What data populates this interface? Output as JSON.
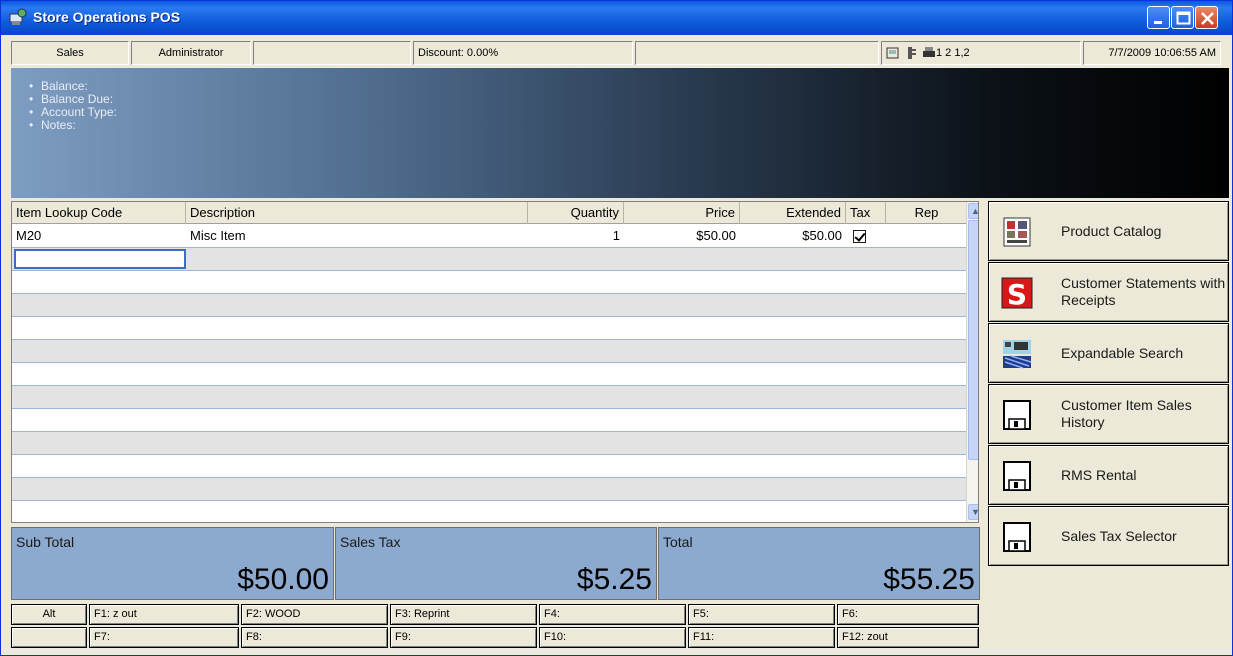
{
  "window": {
    "title": "Store Operations POS"
  },
  "status_bar": {
    "mode": "Sales",
    "user": "Administrator",
    "empty1": "",
    "discount": "Discount: 0.00%",
    "empty2": "",
    "drawers": "1 2 1,2",
    "datetime": "7/7/2009 10:06:55 AM"
  },
  "info_panel": {
    "items": [
      "Balance:",
      "Balance Due:",
      "Account Type:",
      "Notes:"
    ]
  },
  "grid": {
    "columns": [
      "Item Lookup Code",
      "Description",
      "Quantity",
      "Price",
      "Extended",
      "Tax",
      "Rep"
    ],
    "rows": [
      {
        "code": "M20",
        "description": "Misc Item",
        "quantity": "1",
        "price": "$50.00",
        "extended": "$50.00",
        "tax": true,
        "rep": ""
      }
    ]
  },
  "totals": {
    "subtotal_label": "Sub Total",
    "subtotal": "$50.00",
    "tax_label": "Sales Tax",
    "tax": "$5.25",
    "total_label": "Total",
    "total": "$55.25"
  },
  "fkeys": {
    "alt": "Alt",
    "f1": "F1: z out",
    "f2": "F2: WOOD",
    "f3": "F3: Reprint",
    "f4": "F4:",
    "f5": "F5:",
    "f6": "F6:",
    "f7": "F7:",
    "f8": "F8:",
    "f9": "F9:",
    "f10": "F10:",
    "f11": "F11:",
    "f12": "F12: zout"
  },
  "side_buttons": [
    {
      "label": "Product Catalog",
      "icon": "catalog-icon"
    },
    {
      "label": "Customer Statements with Receipts",
      "icon": "statement-icon"
    },
    {
      "label": "Expandable Search",
      "icon": "search-icon"
    },
    {
      "label": "Customer Item Sales History",
      "icon": "floppy-disk-icon"
    },
    {
      "label": "RMS Rental",
      "icon": "floppy-disk-icon"
    },
    {
      "label": "Sales Tax Selector",
      "icon": "floppy-disk-icon"
    }
  ]
}
